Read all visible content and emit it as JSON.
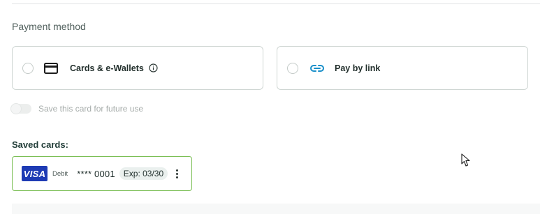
{
  "payment": {
    "section_label": "Payment method",
    "methods": [
      {
        "label": "Cards & e-Wallets",
        "icon": "credit-card-icon",
        "selected": false,
        "has_info": true
      },
      {
        "label": "Pay by link",
        "icon": "link-icon",
        "selected": false,
        "has_info": false
      }
    ],
    "save_card_label": "Save this card for future use",
    "save_card_enabled": false
  },
  "saved_cards": {
    "title": "Saved cards:",
    "cards": [
      {
        "brand": "VISA",
        "type": "Debit",
        "number": "**** 0001",
        "expiry": "Exp: 03/30",
        "selected": true
      }
    ]
  },
  "colors": {
    "visa_blue": "#1e3bb4",
    "selected_border": "#7bbf55",
    "link_icon": "#1a8fc9"
  }
}
